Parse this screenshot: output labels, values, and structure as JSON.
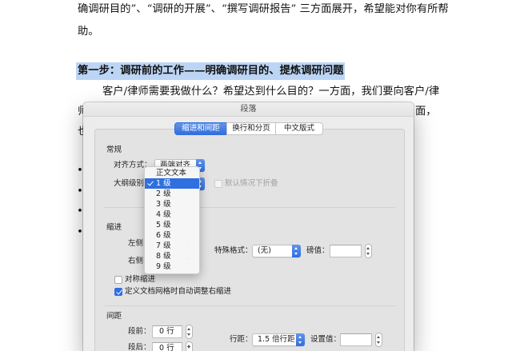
{
  "document": {
    "line1": "确调研目的”、“调研的开展”、“撰写调研报告” 三方面展开，希望能对你有所帮",
    "line2": "助。",
    "heading": "第一步：调研前的工作——明确调研目的、提炼调研问题",
    "line3": "客户/律师需要我做什么？希望达到什么目的？一方面，我们要向客户/律",
    "line4_start": "师",
    "line4_end": "面，",
    "line5_start": "也",
    "bullet": "•"
  },
  "dialog": {
    "title": "段落",
    "tabs": [
      {
        "label": "缩进和间距",
        "selected": true
      },
      {
        "label": "换行和分页",
        "selected": false
      },
      {
        "label": "中文版式",
        "selected": false
      }
    ],
    "general": {
      "heading": "常规",
      "alignment_label": "对齐方式：",
      "alignment_value": "两端对齐",
      "outline_label": "大纲级别：",
      "collapse_label": "默认情况下折叠",
      "collapse_checked": false,
      "collapse_enabled": false
    },
    "indent": {
      "heading": "缩进",
      "left_label": "左侧",
      "right_label": "右侧",
      "special_label": "特殊格式：",
      "special_value": "(无)",
      "by_label": "磅值：",
      "mirror_label": "对称缩进",
      "mirror_checked": false,
      "auto_adjust_label": "定义文档网格时自动调整右缩进",
      "auto_adjust_checked": true
    },
    "spacing": {
      "heading": "间距",
      "before_label": "段前：",
      "before_value": "0 行",
      "after_label": "段后：",
      "after_value": "0 行",
      "line_spacing_label": "行距：",
      "line_spacing_value": "1.5 倍行距",
      "at_label": "设置值："
    }
  },
  "outline_menu": {
    "items": [
      "正文文本",
      "1 级",
      "2 级",
      "3 级",
      "4 级",
      "5 级",
      "6 级",
      "7 级",
      "8 级",
      "9 级"
    ],
    "selected_index": 1
  },
  "colors": {
    "accent": "#2f6fe0",
    "selection_highlight": "#bcd5f5"
  }
}
